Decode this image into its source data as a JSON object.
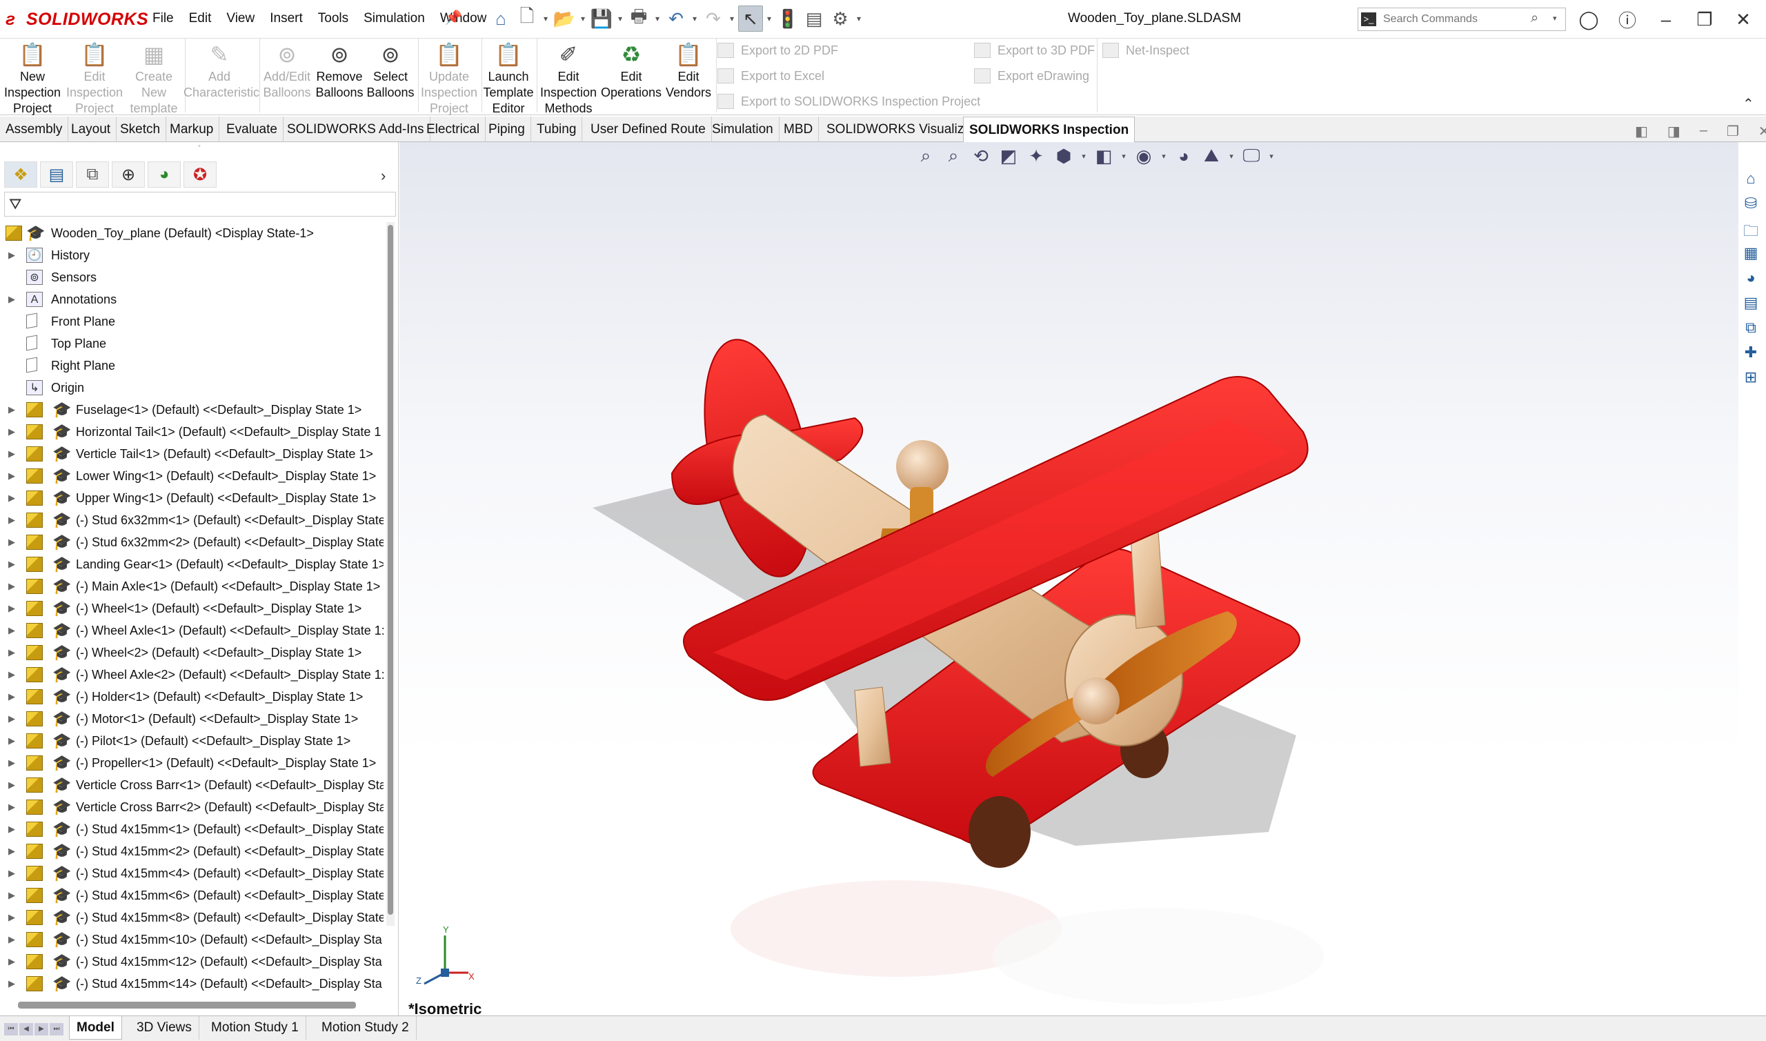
{
  "app": {
    "name": "SOLIDWORKS",
    "window_title": "Wooden_Toy_plane.SLDASM"
  },
  "menu": [
    "File",
    "Edit",
    "View",
    "Insert",
    "Tools",
    "Simulation",
    "Window"
  ],
  "search": {
    "placeholder": "Search Commands"
  },
  "ribbon": {
    "new_inspection_project": "New Inspection Project",
    "edit_inspection_project": "Edit Inspection Project",
    "create_new_template": "Create New template",
    "add_characteristic": "Add Characteristic",
    "add_edit_balloons": "Add/Edit Balloons",
    "remove_balloons": "Remove Balloons",
    "select_balloons": "Select Balloons",
    "update_inspection_project": "Update Inspection Project",
    "launch_template_editor": "Launch Template Editor",
    "edit_inspection_methods": "Edit Inspection Methods",
    "edit_operations": "Edit Operations",
    "edit_vendors": "Edit Vendors",
    "export_2d_pdf": "Export to 2D PDF",
    "export_excel": "Export to Excel",
    "export_sw_inspection": "Export to SOLIDWORKS Inspection Project",
    "export_3d_pdf": "Export to 3D PDF",
    "export_edrawing": "Export eDrawing",
    "net_inspect": "Net-Inspect"
  },
  "command_tabs": [
    "Assembly",
    "Layout",
    "Sketch",
    "Markup",
    "Evaluate",
    "SOLIDWORKS Add-Ins",
    "Electrical",
    "Piping",
    "Tubing",
    "User Defined Route",
    "Simulation",
    "MBD",
    "SOLIDWORKS Visualize",
    "SOLIDWORKS Inspection"
  ],
  "active_tab": "SOLIDWORKS Inspection",
  "tree": {
    "root": "Wooden_Toy_plane (Default) <Display State-1>",
    "fixed_items": [
      {
        "label": "History",
        "icon": "history-icon",
        "expandable": true
      },
      {
        "label": "Sensors",
        "icon": "sensors-icon",
        "expandable": false
      },
      {
        "label": "Annotations",
        "icon": "annotations-icon",
        "expandable": true
      },
      {
        "label": "Front Plane",
        "icon": "plane-icon",
        "expandable": false
      },
      {
        "label": "Top Plane",
        "icon": "plane-icon",
        "expandable": false
      },
      {
        "label": "Right Plane",
        "icon": "plane-icon",
        "expandable": false
      },
      {
        "label": "Origin",
        "icon": "origin-icon",
        "expandable": false
      }
    ],
    "components": [
      "Fuselage<1> (Default) <<Default>_Display State 1>",
      "Horizontal Tail<1> (Default) <<Default>_Display State 1",
      "Verticle Tail<1> (Default) <<Default>_Display State 1>",
      "Lower Wing<1> (Default) <<Default>_Display State 1>",
      "Upper Wing<1> (Default) <<Default>_Display State 1>",
      "(-) Stud 6x32mm<1> (Default) <<Default>_Display State",
      "(-) Stud 6x32mm<2> (Default) <<Default>_Display State",
      "Landing Gear<1> (Default) <<Default>_Display State 1>",
      "(-) Main Axle<1> (Default) <<Default>_Display State 1>",
      "(-) Wheel<1> (Default) <<Default>_Display State 1>",
      "(-) Wheel Axle<1> (Default) <<Default>_Display State 1:",
      "(-) Wheel<2> (Default) <<Default>_Display State 1>",
      "(-) Wheel Axle<2> (Default) <<Default>_Display State 1:",
      "(-) Holder<1> (Default) <<Default>_Display State 1>",
      "(-) Motor<1> (Default) <<Default>_Display State 1>",
      "(-) Pilot<1> (Default) <<Default>_Display State 1>",
      "(-) Propeller<1> (Default) <<Default>_Display State 1>",
      "Verticle Cross Barr<1> (Default) <<Default>_Display Sta",
      "Verticle Cross Barr<2> (Default) <<Default>_Display Sta",
      "(-) Stud 4x15mm<1> (Default) <<Default>_Display State",
      "(-) Stud 4x15mm<2> (Default) <<Default>_Display State",
      "(-) Stud 4x15mm<4> (Default) <<Default>_Display State",
      "(-) Stud 4x15mm<6> (Default) <<Default>_Display State",
      "(-) Stud 4x15mm<8> (Default) <<Default>_Display State",
      "(-) Stud 4x15mm<10> (Default) <<Default>_Display Sta",
      "(-) Stud 4x15mm<12> (Default) <<Default>_Display Sta",
      "(-) Stud 4x15mm<14> (Default) <<Default>_Display Sta"
    ]
  },
  "viewport": {
    "view_name": "*Isometric",
    "triad": {
      "x": "X",
      "y": "Y",
      "z": "Z"
    }
  },
  "bottom_tabs": [
    "Model",
    "3D Views",
    "Motion Study 1",
    "Motion Study 2"
  ],
  "active_bottom_tab": "Model",
  "colors": {
    "brand": "#d40000",
    "plane_red": "#e8141a",
    "wood": "#e6c29a",
    "propeller": "#d4781f"
  }
}
